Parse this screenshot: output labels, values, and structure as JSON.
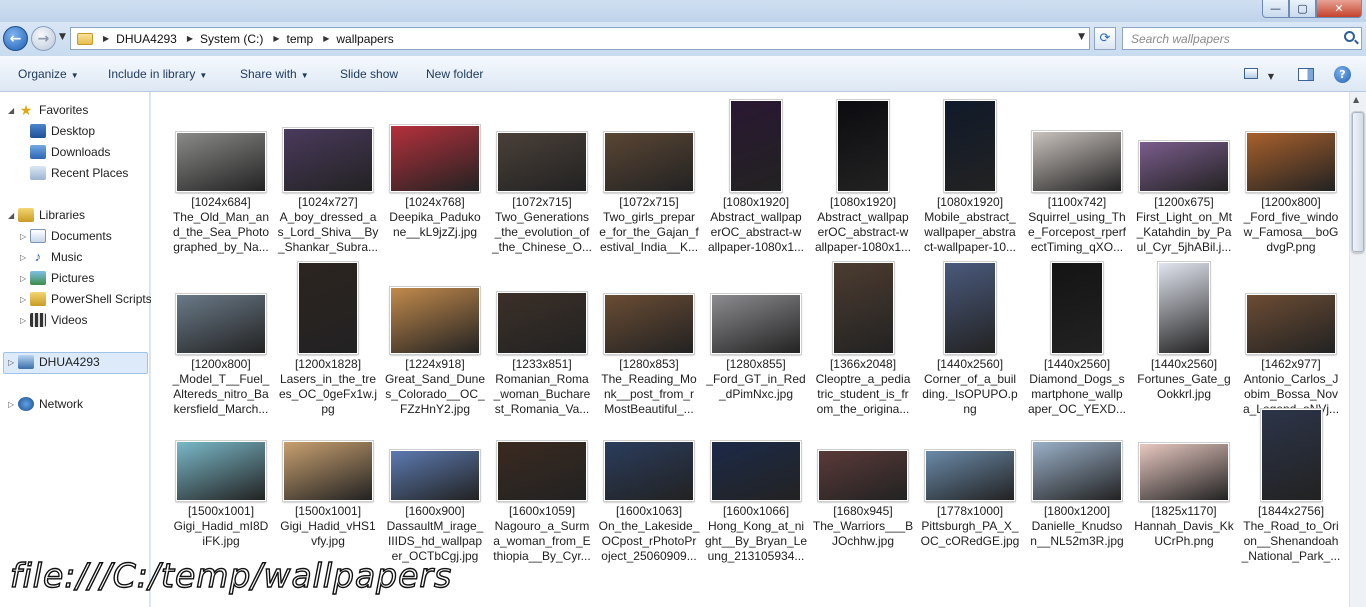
{
  "window": {
    "controls": {
      "minimize": "—",
      "maximize": "▢",
      "close": "✕"
    }
  },
  "address": {
    "breadcrumbs": [
      "DHUA4293",
      "System (C:)",
      "temp",
      "wallpapers"
    ],
    "search_placeholder": "Search wallpapers"
  },
  "toolbar": {
    "organize": "Organize",
    "include_in_library": "Include in library",
    "share_with": "Share with",
    "slide_show": "Slide show",
    "new_folder": "New folder"
  },
  "nav": {
    "favorites": "Favorites",
    "desktop": "Desktop",
    "downloads": "Downloads",
    "recent_places": "Recent Places",
    "libraries": "Libraries",
    "documents": "Documents",
    "music": "Music",
    "pictures": "Pictures",
    "powershell_scripts": "PowerShell Scripts",
    "videos": "Videos",
    "computer": "DHUA4293",
    "network": "Network"
  },
  "files": [
    {
      "label": "[1024x684]\nThe_Old_Man_an\nd_the_Sea_Photo\ngraphed_by_Na...",
      "color": "#8a8a88"
    },
    {
      "label": "[1024x727]\nA_boy_dressed_a\ns_Lord_Shiva__By\n_Shankar_Subra...",
      "color": "#4a3a5c"
    },
    {
      "label": "[1024x768]\nDeepika_Paduko\nne__kL9jzZj.jpg",
      "color": "#b5303c"
    },
    {
      "label": "[1072x715]\nTwo_Generations\n_the_evolution_of\n_the_Chinese_O...",
      "color": "#4a4038"
    },
    {
      "label": "[1072x715]\nTwo_girls_prepar\ne_for_the_Gajan_f\nestival_India__K...",
      "color": "#5a4634"
    },
    {
      "label": "[1080x1920]\nAbstract_wallpap\nerOC_abstract-w\nallpaper-1080x1...",
      "color": "#2a1832"
    },
    {
      "label": "[1080x1920]\nAbstract_wallpap\nerOC_abstract-w\nallpaper-1080x1...",
      "color": "#0c0c10"
    },
    {
      "label": "[1080x1920]\nMobile_abstract_\nwallpaper_abstra\nct-wallpaper-10...",
      "color": "#101a2a"
    },
    {
      "label": "[1100x742]\nSquirrel_using_Th\ne_Forcepost_rperf\nectTiming_qXO...",
      "color": "#c9c2bd"
    },
    {
      "label": "[1200x675]\nFirst_Light_on_Mt\n_Katahdin_by_Pa\nul_Cyr_5jhABil.j...",
      "color": "#7a5c8c"
    },
    {
      "label": "[1200x800]\n_Ford_five_windo\nw_Famosa__boG\ndvgP.png",
      "color": "#a8602c"
    },
    {
      "label": "[1200x800]\n_Model_T__Fuel_\nAltereds_nitro_Ba\nkersfield_March...",
      "color": "#6a7a88"
    },
    {
      "label": "[1200x1828]\nLasers_in_the_tre\nes_OC_0geFx1w.j\npg",
      "color": "#2c2420"
    },
    {
      "label": "[1224x918]\nGreat_Sand_Dune\ns_Colorado__OC_\nFZzHnY2.jpg",
      "color": "#c28a4c"
    },
    {
      "label": "[1233x851]\nRomanian_Roma\n_woman_Buchare\nst_Romania_Va...",
      "color": "#3c3028"
    },
    {
      "label": "[1280x853]\nThe_Reading_Mo\nnk__post_from_r\nMostBeautiful_...",
      "color": "#6a4c34"
    },
    {
      "label": "[1280x855]\n_Ford_GT_in_Red\n_dPimNxc.jpg",
      "color": "#8c8c90"
    },
    {
      "label": "[1366x2048]\nCleoptre_a_pedia\ntric_student_is_fr\nom_the_origina...",
      "color": "#4c3c30"
    },
    {
      "label": "[1440x2560]\nCorner_of_a_buil\nding._IsOPUPO.p\nng",
      "color": "#4a5a7c"
    },
    {
      "label": "[1440x2560]\nDiamond_Dogs_s\nmartphone_wallp\naper_OC_YEXD...",
      "color": "#141414"
    },
    {
      "label": "[1440x2560]\nFortunes_Gate_g\nOokkrl.jpg",
      "color": "#e0e4ee"
    },
    {
      "label": "[1462x977]\nAntonio_Carlos_J\nobim_Bossa_Nov\na_Legend_oNVj...",
      "color": "#6c4c34"
    },
    {
      "label": "[1500x1001]\nGigi_Hadid_mI8D\niFK.jpg",
      "color": "#7ab8c8"
    },
    {
      "label": "[1500x1001]\nGigi_Hadid_vHS1\nvfy.jpg",
      "color": "#c8a070"
    },
    {
      "label": "[1600x900]\nDassaultM_irage_\nIIIDS_hd_wallpap\ner_OCTbCgj.jpg",
      "color": "#5c7ab0"
    },
    {
      "label": "[1600x1059]\nNagouro_a_Surm\na_woman_from_E\nthiopia__By_Cyr...",
      "color": "#3a2a20"
    },
    {
      "label": "[1600x1063]\nOn_the_Lakeside_\nOCpost_rPhotoPr\noject_25060909...",
      "color": "#2a3c5c"
    },
    {
      "label": "[1600x1066]\nHong_Kong_at_ni\nght__By_Bryan_Le\nung_213105934...",
      "color": "#1c2a48"
    },
    {
      "label": "[1680x945]\nThe_Warriors___B\nJOchhw.jpg",
      "color": "#5a3a38"
    },
    {
      "label": "[1778x1000]\nPittsburgh_PA_X_\nOC_cORedGE.jpg",
      "color": "#6a8aa8"
    },
    {
      "label": "[1800x1200]\nDanielle_Knudso\nn__NL52m3R.jpg",
      "color": "#9ab0c8"
    },
    {
      "label": "[1825x1170]\nHannah_Davis_Kk\nUCrPh.png",
      "color": "#e8c8c0"
    },
    {
      "label": "[1844x2756]\nThe_Road_to_Ori\non__Shenandoah\n_National_Park_...",
      "color": "#2c3448"
    }
  ],
  "overlay_text": "file:///C:/temp/wallpapers"
}
